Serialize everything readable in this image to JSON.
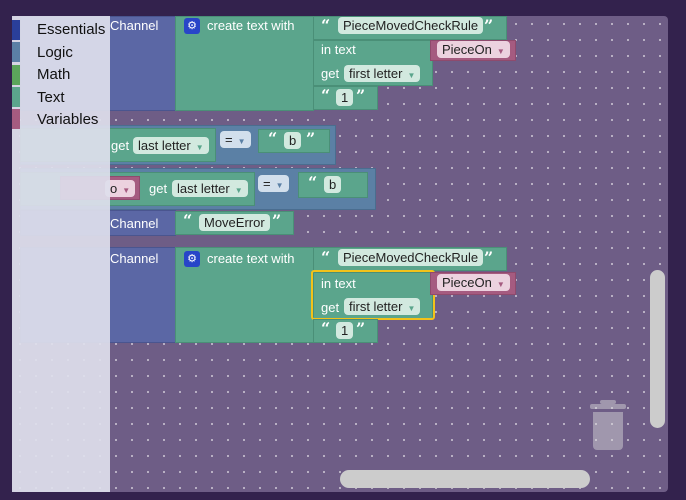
{
  "toolbox": {
    "categories": [
      {
        "label": "Essentials",
        "color": "#2a3f9a"
      },
      {
        "label": "Logic",
        "color": "#5b80a5"
      },
      {
        "label": "Math",
        "color": "#5ba55b"
      },
      {
        "label": "Text",
        "color": "#5ba58c"
      },
      {
        "label": "Variables",
        "color": "#a55b80"
      }
    ]
  },
  "blocks": {
    "channel": "Channel",
    "create_text": "create text with",
    "rule": "PieceMovedCheckRule",
    "in_text": "in text",
    "piece_on": "PieceOn",
    "get": "get",
    "first_letter": "first letter",
    "last_letter": "last letter",
    "one": "1",
    "eq": "=",
    "b": "b",
    "move_error": "MoveError",
    "piece_on_partial": "o"
  }
}
